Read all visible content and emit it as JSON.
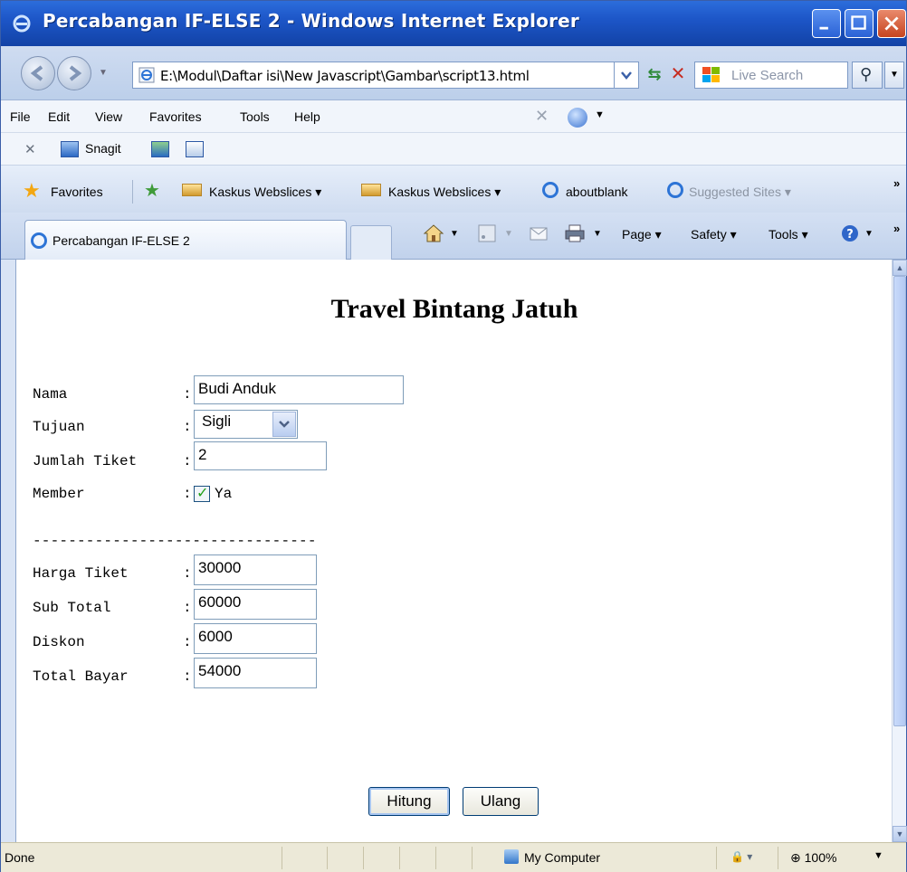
{
  "window": {
    "title": "Percabangan IF-ELSE 2 - Windows Internet Explorer"
  },
  "address_bar": {
    "url": "E:\\Modul\\Daftar isi\\New Javascript\\Gambar\\script13.html",
    "search_placeholder": "Live Search"
  },
  "menu": [
    "File",
    "Edit",
    "View",
    "Favorites",
    "Tools",
    "Help"
  ],
  "snagit_bar": {
    "label": "Snagit"
  },
  "favorites_bar": {
    "favorites_label": "Favorites",
    "items": [
      "Kaskus Webslices ▾",
      "Kaskus Webslices ▾",
      "aboutblank",
      "Suggested Sites ▾"
    ],
    "overflow": "»"
  },
  "tab_row": {
    "active_tab": "Percabangan IF-ELSE 2",
    "commands": [
      "Page ▾",
      "Safety ▾",
      "Tools ▾"
    ],
    "overflow": "»"
  },
  "page": {
    "heading": "Travel Bintang Jatuh",
    "labels": {
      "nama": "Nama",
      "tujuan": "Tujuan",
      "jumlah_tiket": "Jumlah Tiket",
      "member": "Member",
      "harga_tiket": "Harga Tiket",
      "sub_total": "Sub Total",
      "diskon": "Diskon",
      "total_bayar": "Total Bayar"
    },
    "colon": ":",
    "values": {
      "nama": "Budi Anduk",
      "tujuan": "Sigli",
      "jumlah_tiket": "2",
      "member_checked": true,
      "member_label": "Ya",
      "harga_tiket": "30000",
      "sub_total": "60000",
      "diskon": "6000",
      "total_bayar": "54000"
    },
    "separator": "--------------------------------",
    "buttons": {
      "hitung": "Hitung",
      "ulang": "Ulang"
    }
  },
  "status_bar": {
    "status": "Done",
    "zone": "My Computer",
    "zoom": "100%"
  }
}
